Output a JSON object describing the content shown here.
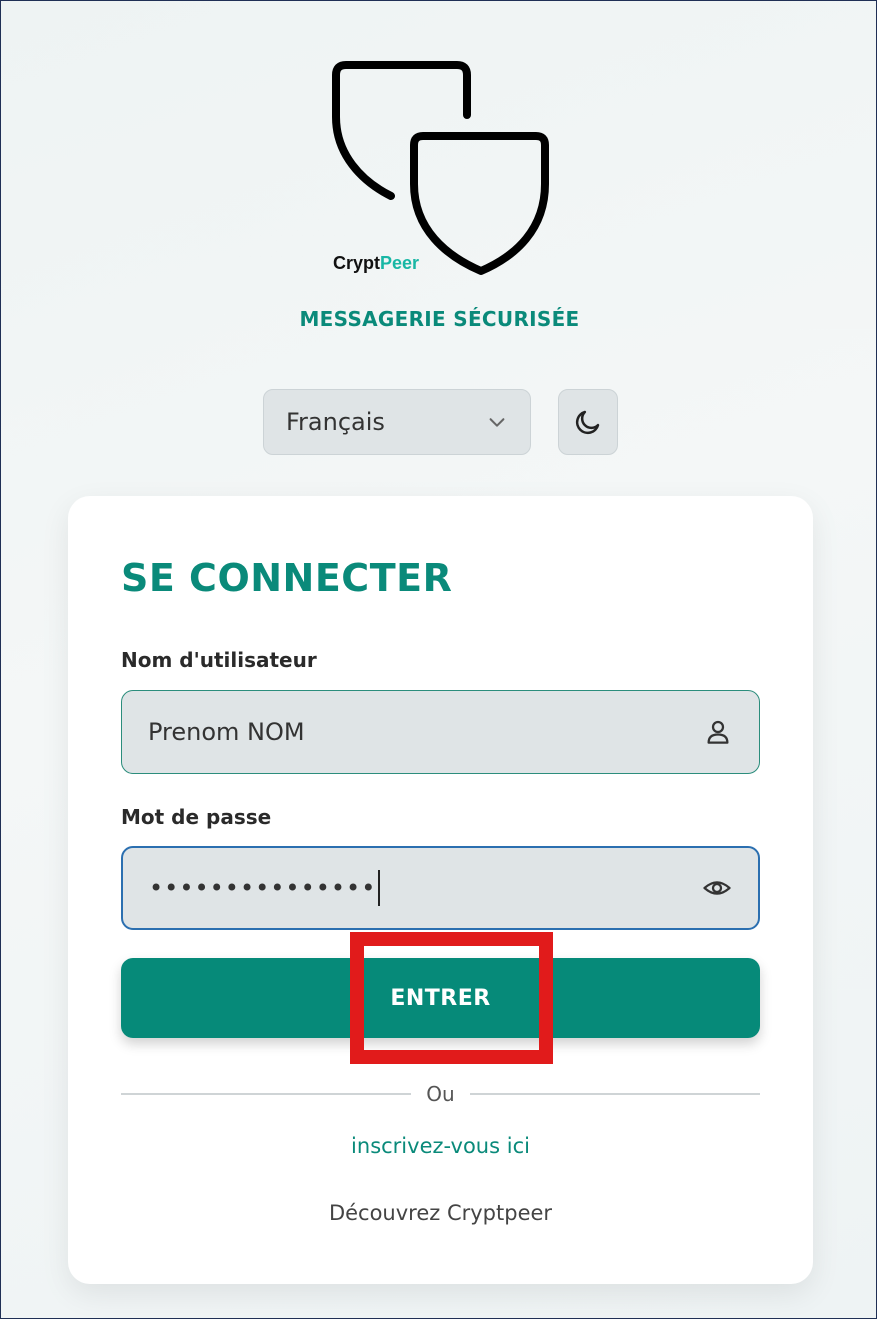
{
  "brand": {
    "name_part1": "Crypt",
    "name_part2": "Peer",
    "tagline": "MESSAGERIE SÉCURISÉE"
  },
  "language": {
    "selected": "Français"
  },
  "login": {
    "title": "SE CONNECTER",
    "username_label": "Nom d'utilisateur",
    "username_value": "Prenom NOM",
    "password_label": "Mot de passe",
    "password_value": "•••••••••••••••",
    "submit_label": "ENTRER",
    "or_label": "Ou",
    "signup_link": "inscrivez-vous ici",
    "discover_link": "Découvrez Cryptpeer"
  },
  "colors": {
    "accent": "#068a79",
    "highlight": "#e11b1b",
    "focus_border": "#2b6fb0"
  },
  "icons": {
    "language_dropdown": "chevron-down-icon",
    "theme_toggle": "moon-icon",
    "username_field": "user-icon",
    "password_field": "eye-icon"
  }
}
